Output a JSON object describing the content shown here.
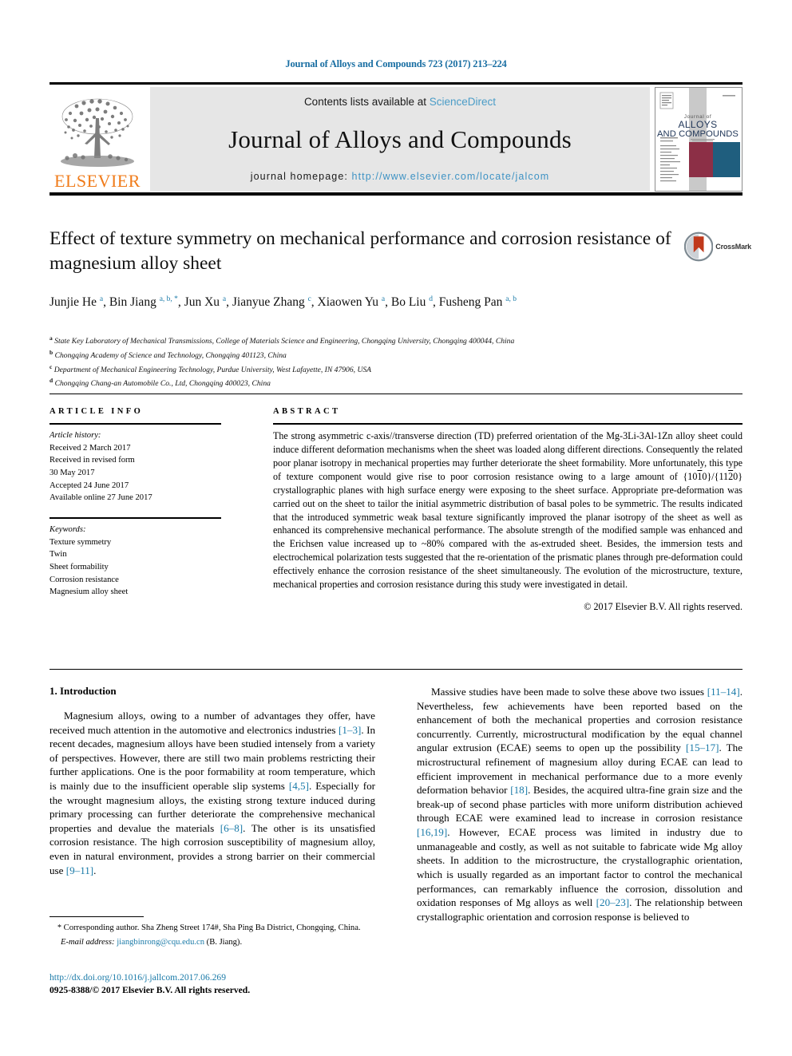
{
  "running_head": "Journal of Alloys and Compounds 723 (2017) 213–224",
  "masthead": {
    "publisher_name": "ELSEVIER",
    "contents_prefix": "Contents lists available at ",
    "contents_link": "ScienceDirect",
    "journal_title": "Journal of Alloys and Compounds",
    "homepage_prefix": "journal homepage: ",
    "homepage_url": "http://www.elsevier.com/locate/jalcom",
    "cover": {
      "line1": "Journal of",
      "line2": "ALLOYS",
      "line3": "AND COMPOUNDS"
    }
  },
  "article": {
    "title": "Effect of texture symmetry on mechanical performance and corrosion resistance of magnesium alloy sheet",
    "crossmark_label": "CrossMark",
    "authors_html": "Junjie He <sup>a</sup>, Bin Jiang <sup>a, b, *</sup>, Jun Xu <sup>a</sup>, Jianyue Zhang <sup>c</sup>, Xiaowen Yu <sup>a</sup>, Bo Liu <sup>d</sup>, Fusheng Pan <sup>a, b</sup>",
    "affiliations": [
      {
        "mark": "a",
        "text": "State Key Laboratory of Mechanical Transmissions, College of Materials Science and Engineering, Chongqing University, Chongqing 400044, China"
      },
      {
        "mark": "b",
        "text": "Chongqing Academy of Science and Technology, Chongqing 401123, China"
      },
      {
        "mark": "c",
        "text": "Department of Mechanical Engineering Technology, Purdue University, West Lafayette, IN 47906, USA"
      },
      {
        "mark": "d",
        "text": "Chongqing Chang-an Automobile Co., Ltd, Chongqing 400023, China"
      }
    ]
  },
  "article_info": {
    "heading": "ARTICLE INFO",
    "history_label": "Article history:",
    "history": [
      "Received 2 March 2017",
      "Received in revised form",
      "30 May 2017",
      "Accepted 24 June 2017",
      "Available online 27 June 2017"
    ],
    "keywords_label": "Keywords:",
    "keywords": [
      "Texture symmetry",
      "Twin",
      "Sheet formability",
      "Corrosion resistance",
      "Magnesium alloy sheet"
    ]
  },
  "abstract": {
    "heading": "ABSTRACT",
    "text_html": "The strong asymmetric c-axis//transverse direction (TD) preferred orientation of the Mg-3Li-3Al-1Zn alloy sheet could induce different deformation mechanisms when the sheet was loaded along different directions. Consequently the related poor planar isotropy in mechanical properties may further deteriorate the sheet formability. More unfortunately, this type of texture component would give rise to poor corrosion resistance owing to a large amount of {10<span class=\"ovl\">1</span>0}/{11<span class=\"ovl\">2</span>0} crystallographic planes with high surface energy were exposing to the sheet surface. Appropriate pre-deformation was carried out on the sheet to tailor the initial asymmetric distribution of basal poles to be symmetric. The results indicated that the introduced symmetric weak basal texture significantly improved the planar isotropy of the sheet as well as enhanced its comprehensive mechanical performance. The absolute strength of the modified sample was enhanced and the Erichsen value increased up to ~80% compared with the as-extruded sheet. Besides, the immersion tests and electrochemical polarization tests suggested that the re-orientation of the prismatic planes through pre-deformation could effectively enhance the corrosion resistance of the sheet simultaneously. The evolution of the microstructure, texture, mechanical properties and corrosion resistance during this study were investigated in detail.",
    "copyright": "© 2017 Elsevier B.V. All rights reserved."
  },
  "body": {
    "section_number_title": "1.  Introduction",
    "left_paragraph_html": "Magnesium alloys, owing to a number of advantages they offer, have received much attention in the automotive and electronics industries <span class=\"ref\">[1–3]</span>. In recent decades, magnesium alloys have been studied intensely from a variety of perspectives. However, there are still two main problems restricting their further applications. One is the poor formability at room temperature, which is mainly due to the insufficient operable slip systems <span class=\"ref\">[4,5]</span>. Especially for the wrought magnesium alloys, the existing strong texture induced during primary processing can further deteriorate the comprehensive mechanical properties and devalue the materials <span class=\"ref\">[6–8]</span>. The other is its unsatisfied corrosion resistance. The high corrosion susceptibility of magnesium alloy, even in natural environment, provides a strong barrier on their commercial use <span class=\"ref\">[9–11]</span>.",
    "right_paragraph_html": "Massive studies have been made to solve these above two issues <span class=\"ref\">[11–14]</span>. Nevertheless, few achievements have been reported based on the enhancement of both the mechanical properties and corrosion resistance concurrently. Currently, microstructural modification by the equal channel angular extrusion (ECAE) seems to open up the possibility <span class=\"ref\">[15–17]</span>. The microstructural refinement of magnesium alloy during ECAE can lead to efficient improvement in mechanical performance due to a more evenly deformation behavior <span class=\"ref\">[18]</span>. Besides, the acquired ultra-fine grain size and the break-up of second phase particles with more uniform distribution achieved through ECAE were examined lead to increase in corrosion resistance <span class=\"ref\">[16,19]</span>. However, ECAE process was limited in industry due to unmanageable and costly, as well as not suitable to fabricate wide Mg alloy sheets. In addition to the microstructure, the crystallographic orientation, which is usually regarded as an important factor to control the mechanical performances, can remarkably influence the corrosion, dissolution and oxidation responses of Mg alloys as well <span class=\"ref\">[20–23]</span>. The relationship between crystallographic orientation and corrosion response is believed to"
  },
  "footnote": {
    "corresponding_html": "<span class=\"star\">*</span> Corresponding author. Sha Zheng Street 174#, Sha Ping Ba District, Chongqing, China.",
    "email_label": "E-mail address:",
    "email": "jiangbinrong@cqu.edu.cn",
    "email_owner": "(B. Jiang)."
  },
  "footer": {
    "doi": "http://dx.doi.org/10.1016/j.jallcom.2017.06.269",
    "issn_line": "0925-8388/© 2017 Elsevier B.V. All rights reserved."
  },
  "colors": {
    "link_blue": "#1a7aa8",
    "elsevier_orange": "#F07C1B",
    "masthead_grey": "#e6e6e6",
    "cover_maroon": "#8c2f46",
    "cover_teal": "#1f5e7e"
  }
}
